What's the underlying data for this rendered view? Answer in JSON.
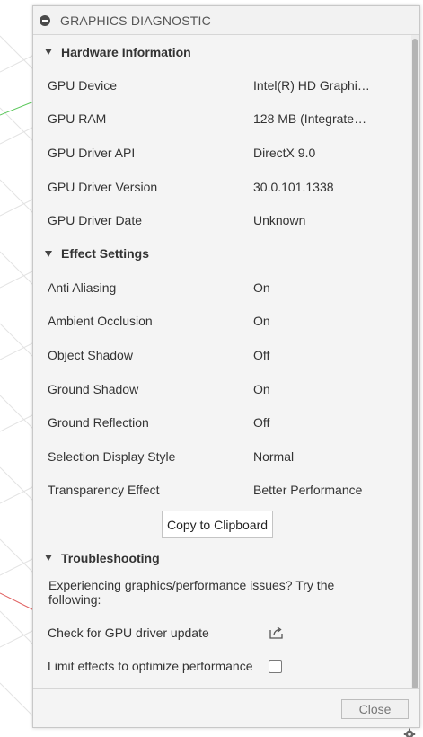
{
  "dialog": {
    "title": "GRAPHICS DIAGNOSTIC",
    "title_icon": "minus-circle-icon"
  },
  "hardware": {
    "header": "Hardware Information",
    "rows": [
      {
        "label": "GPU Device",
        "value": "Intel(R) HD Graphic..."
      },
      {
        "label": "GPU RAM",
        "value": "128 MB (Integrated..."
      },
      {
        "label": "GPU Driver API",
        "value": "DirectX 9.0"
      },
      {
        "label": "GPU Driver Version",
        "value": "30.0.101.1338"
      },
      {
        "label": "GPU Driver Date",
        "value": "Unknown"
      }
    ]
  },
  "effects": {
    "header": "Effect Settings",
    "rows": [
      {
        "label": "Anti Aliasing",
        "value": "On"
      },
      {
        "label": "Ambient Occlusion",
        "value": "On"
      },
      {
        "label": "Object Shadow",
        "value": "Off"
      },
      {
        "label": "Ground Shadow",
        "value": "On"
      },
      {
        "label": "Ground Reflection",
        "value": "Off"
      },
      {
        "label": "Selection Display Style",
        "value": "Normal"
      },
      {
        "label": "Transparency Effect",
        "value": "Better Performance"
      }
    ]
  },
  "copy_button": "Copy to Clipboard",
  "troubleshooting": {
    "header": "Troubleshooting",
    "description": "Experiencing graphics/performance issues? Try the following:",
    "items": [
      {
        "label": "Check for GPU driver update",
        "control": "external-link-icon"
      },
      {
        "label": "Limit effects to optimize performance",
        "control": "checkbox",
        "checked": false
      }
    ]
  },
  "footer": {
    "close_label": "Close"
  },
  "colors": {
    "panel_bg": "#f4f4f4",
    "scroll_thumb": "#b4b4b4",
    "axis_green": "#5cc85c",
    "axis_red": "#e06060"
  }
}
